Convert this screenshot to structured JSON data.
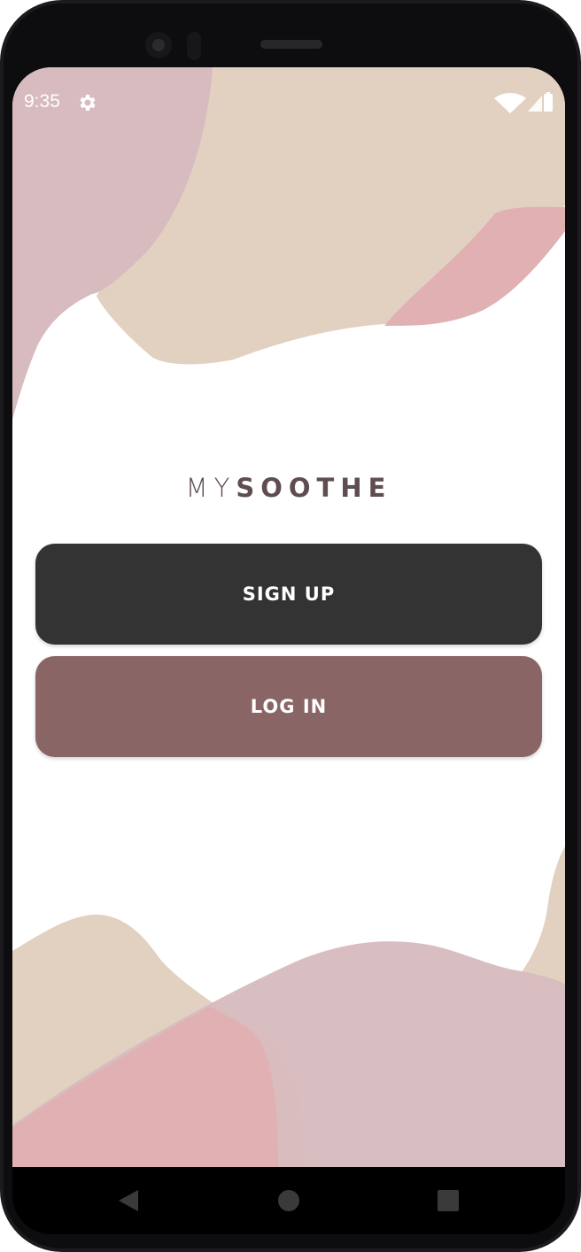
{
  "status_bar": {
    "time": "9:35",
    "settings_icon": "gear-icon",
    "wifi_icon": "wifi-icon",
    "signal_icon": "cellular-signal-icon",
    "battery_icon": "battery-icon"
  },
  "app": {
    "logo_light": "MY",
    "logo_bold": "SOOTHE"
  },
  "buttons": {
    "signup_label": "SIGN UP",
    "login_label": "LOG IN"
  },
  "nav_bar": {
    "back_icon": "back-triangle-icon",
    "home_icon": "home-circle-icon",
    "recents_icon": "recents-square-icon"
  },
  "colors": {
    "signup_bg": "#333333",
    "login_bg": "#8a6566",
    "beige": "#e2d0c0",
    "mauve": "#d7bbbe",
    "pink": "#e1b0b3",
    "logo": "#5f4d50"
  }
}
